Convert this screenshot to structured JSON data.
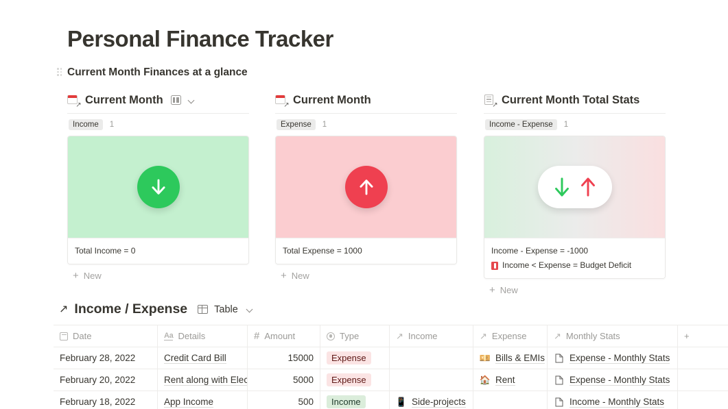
{
  "page": {
    "title": "Personal Finance Tracker",
    "section_heading": "Current Month Finances at a glance",
    "drag_handle_icon": "drag-handle-icon"
  },
  "cards": [
    {
      "icon": "calendar-link-icon",
      "title": "Current Month",
      "view_icon": "board-view-icon",
      "chevron_icon": "chevron-down-icon",
      "has_view_switcher": true,
      "group_label": "Income",
      "group_count": "1",
      "cover_style": "green",
      "cover_icon": "arrow-down-circle-icon",
      "footer_lines": [
        "Total Income = 0"
      ],
      "new_label": "New",
      "new_icon": "plus-icon"
    },
    {
      "icon": "calendar-link-icon",
      "title": "Current Month",
      "has_view_switcher": false,
      "group_label": "Expense",
      "group_count": "1",
      "cover_style": "red",
      "cover_icon": "arrow-up-circle-icon",
      "footer_lines": [
        "Total Expense = 1000"
      ],
      "new_label": "New",
      "new_icon": "plus-icon"
    },
    {
      "icon": "document-link-icon",
      "title": "Current Month Total Stats",
      "has_view_switcher": false,
      "group_label": "Income - Expense",
      "group_count": "1",
      "cover_style": "gradient",
      "cover_icon": "arrows-down-up-pill-icon",
      "footer_lines": [
        "Income - Expense = -1000",
        "Income < Expense = Budget Deficit"
      ],
      "footer_badge_icon": "red-book-icon",
      "new_label": "New",
      "new_icon": "plus-icon"
    }
  ],
  "database": {
    "link_icon": "arrow-up-right-icon",
    "title": "Income / Expense",
    "view_icon": "table-view-icon",
    "view_name": "Table",
    "view_chevron_icon": "chevron-down-icon",
    "columns": [
      {
        "label": "Date",
        "icon": "calendar-icon"
      },
      {
        "label": "Details",
        "icon": "text-aa-icon"
      },
      {
        "label": "Amount",
        "icon": "number-hash-icon"
      },
      {
        "label": "Type",
        "icon": "select-circle-icon"
      },
      {
        "label": "Income",
        "icon": "relation-arrow-icon"
      },
      {
        "label": "Expense",
        "icon": "relation-arrow-icon"
      },
      {
        "label": "Monthly Stats",
        "icon": "relation-arrow-icon"
      }
    ],
    "add_column_label": "+",
    "rows": [
      {
        "date": "February 28, 2022",
        "details": "Credit Card Bill",
        "amount": "15000",
        "type": "Expense",
        "type_style": "expense",
        "income": "",
        "income_icon": "",
        "expense": "Bills & EMIs",
        "expense_icon": "💴",
        "stats": "Expense - Monthly Stats",
        "stats_icon": "page-icon"
      },
      {
        "date": "February 20, 2022",
        "details": "Rent along with Elec",
        "amount": "5000",
        "type": "Expense",
        "type_style": "expense",
        "income": "",
        "income_icon": "",
        "expense": "Rent",
        "expense_icon": "🏠",
        "stats": "Expense - Monthly Stats",
        "stats_icon": "page-icon"
      },
      {
        "date": "February 18, 2022",
        "details": "App Income",
        "amount": "500",
        "type": "Income",
        "type_style": "income",
        "income": "Side-projects",
        "income_icon": "📱",
        "expense": "",
        "expense_icon": "",
        "stats": "Income - Monthly Stats",
        "stats_icon": "page-icon"
      }
    ]
  },
  "colors": {
    "green_accent": "#2dc95c",
    "red_accent": "#ef4050",
    "green_cover": "#c4f0cf",
    "red_cover": "#fbcdd0",
    "expense_tag_bg": "#fbe4e4",
    "income_tag_bg": "#dbeddb",
    "text": "#37352f",
    "muted": "#9b9a97"
  }
}
